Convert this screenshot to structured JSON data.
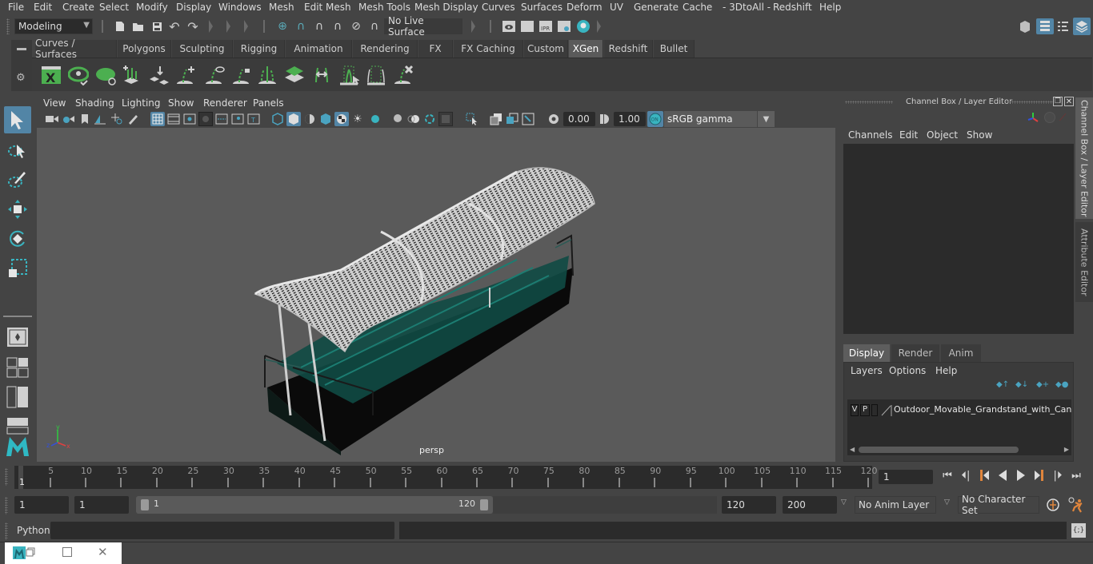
{
  "menubar": {
    "items": [
      "File",
      "Edit",
      "Create",
      "Select",
      "Modify",
      "Display",
      "Windows",
      "Mesh",
      "Edit Mesh",
      "Mesh Tools",
      "Mesh Display",
      "Curves",
      "Surfaces",
      "Deform",
      "UV",
      "Generate",
      "Cache",
      "- 3DtoAll -",
      "Redshift",
      "Help"
    ]
  },
  "statusline": {
    "workspace": "Modeling",
    "live_surface": "No Live Surface",
    "render_icons": [
      "render-view-icon",
      "render-frame-icon",
      "ipr-render-icon",
      "render-settings-icon",
      "hypershade-icon"
    ],
    "ipr_label": "IPR"
  },
  "shelf": {
    "tabs": [
      "Curves / Surfaces",
      "Polygons",
      "Sculpting",
      "Rigging",
      "Animation",
      "Rendering",
      "FX",
      "FX Caching",
      "Custom",
      "XGen",
      "Redshift",
      "Bullet"
    ],
    "active_tab": "XGen",
    "icons": [
      "xgen-editor-icon",
      "xgen-preview-icon",
      "xgen-clear-preview-icon",
      "add-description-icon",
      "place-guides-icon",
      "add-guide-icon",
      "toggle-guide-visibility-icon",
      "lock-guides-icon",
      "split-guides-icon",
      "patch-icon",
      "sculpt-guides-icon",
      "grooming-icon",
      "interactive-groom-icon",
      "delete-groom-icon"
    ]
  },
  "viewport": {
    "menu": [
      "View",
      "Shading",
      "Lighting",
      "Show",
      "Renderer",
      "Panels"
    ],
    "exposure": "0.00",
    "gamma": "1.00",
    "color_mgmt_badge": "ON",
    "color_space": "sRGB gamma",
    "camera": "persp",
    "axis_labels": {
      "x": "x",
      "y": "y",
      "z": "z"
    }
  },
  "channel_box": {
    "title": "Channel Box / Layer Editor",
    "menu": [
      "Channels",
      "Edit",
      "Object",
      "Show"
    ]
  },
  "layer_editor": {
    "tabs": [
      "Display",
      "Render",
      "Anim"
    ],
    "active_tab": "Display",
    "menu": [
      "Layers",
      "Options",
      "Help"
    ],
    "layers": [
      {
        "v": "V",
        "p": "P",
        "name": "Outdoor_Movable_Grandstand_with_Canopy"
      }
    ]
  },
  "side_tabs": [
    "Channel Box / Layer Editor",
    "Attribute Editor"
  ],
  "timeline": {
    "ticks": [
      5,
      10,
      15,
      20,
      25,
      30,
      35,
      40,
      45,
      50,
      55,
      60,
      65,
      70,
      75,
      80,
      85,
      90,
      95,
      100,
      105,
      110,
      115,
      120
    ],
    "start_label": "1",
    "current_frame": "1",
    "range_min": 1,
    "range_max": 120
  },
  "range": {
    "start_frame": "1",
    "playback_start": "1",
    "slider_start": "1",
    "slider_end": "120",
    "playback_end": "120",
    "end_frame": "200",
    "anim_layer": "No Anim Layer",
    "character_set": "No Character Set"
  },
  "command_line": {
    "language": "Python",
    "input": "",
    "output": ""
  },
  "colors": {
    "accent": "#5285a6",
    "teal": "#39b4c0",
    "xgen_green": "#4caf50",
    "key_orange": "#e0853c"
  }
}
